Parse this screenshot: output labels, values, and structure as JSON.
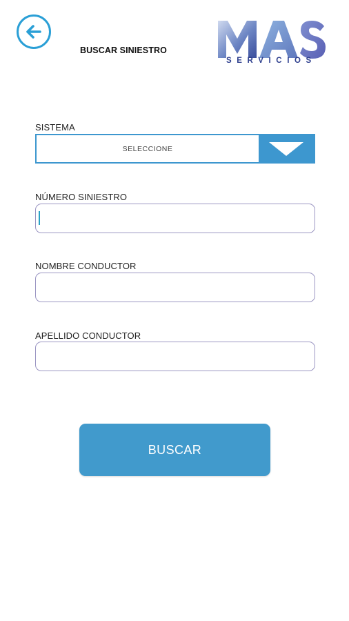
{
  "header": {
    "title": "BUSCAR SINIESTRO",
    "back_icon": "arrow-left-icon",
    "logo": {
      "word": "MAS",
      "subtitle": "SERVICIOS"
    }
  },
  "form": {
    "sistema": {
      "label": "SISTEMA",
      "selected": "SELECCIONE",
      "arrow_icon": "chevron-down-icon"
    },
    "numero_siniestro": {
      "label": "NÚMERO SINIESTRO",
      "value": "",
      "placeholder": ""
    },
    "nombre_conductor": {
      "label": "NOMBRE CONDUCTOR",
      "value": "",
      "placeholder": ""
    },
    "apellido_conductor": {
      "label": "APELLIDO CONDUCTOR",
      "value": "",
      "placeholder": ""
    }
  },
  "actions": {
    "buscar_label": "BUSCAR"
  },
  "colors": {
    "accent": "#2a9fd6",
    "button": "#419acc",
    "select_border": "#3d97cf",
    "input_border": "#9a95c2",
    "logo_dark": "#2e3f8e"
  }
}
